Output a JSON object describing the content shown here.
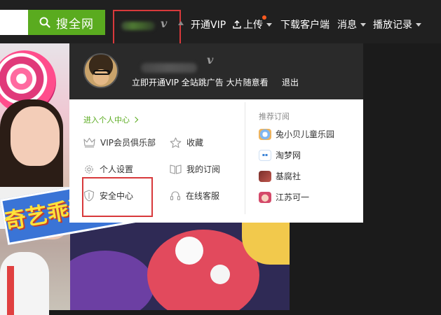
{
  "topbar": {
    "search_input_value": "",
    "search_button_label": "搜全网",
    "user_v_badge": "v",
    "nav": [
      {
        "label": "开通VIP"
      },
      {
        "label": "上传"
      },
      {
        "label": "下载客户端"
      },
      {
        "label": "消息"
      },
      {
        "label": "播放记录"
      }
    ]
  },
  "banner": {
    "headline": "奇艺乖诞上线"
  },
  "dropdown": {
    "v_badge": "v",
    "vip_promo": "立即开通VIP 全站跳广告 大片随意看",
    "logout": "退出",
    "personal_center": "进入个人中心",
    "menu": [
      {
        "label": "VIP会员俱乐部",
        "icon": "crown-icon"
      },
      {
        "label": "收藏",
        "icon": "star-icon"
      },
      {
        "label": "个人设置",
        "icon": "gear-icon"
      },
      {
        "label": "我的订阅",
        "icon": "book-icon"
      },
      {
        "label": "安全中心",
        "icon": "shield-icon"
      },
      {
        "label": "在线客服",
        "icon": "headset-icon"
      }
    ],
    "recommend_title": "推荐订阅",
    "recommend": [
      {
        "label": "兔小贝儿童乐园"
      },
      {
        "label": "淘梦网"
      },
      {
        "label": "基腐社"
      },
      {
        "label": "江苏可一"
      }
    ]
  },
  "colors": {
    "accent_green": "#5aab1f",
    "highlight_red": "#d8393b",
    "header_dark": "#2a2a2a",
    "notify_dot": "#ff5a1f"
  }
}
